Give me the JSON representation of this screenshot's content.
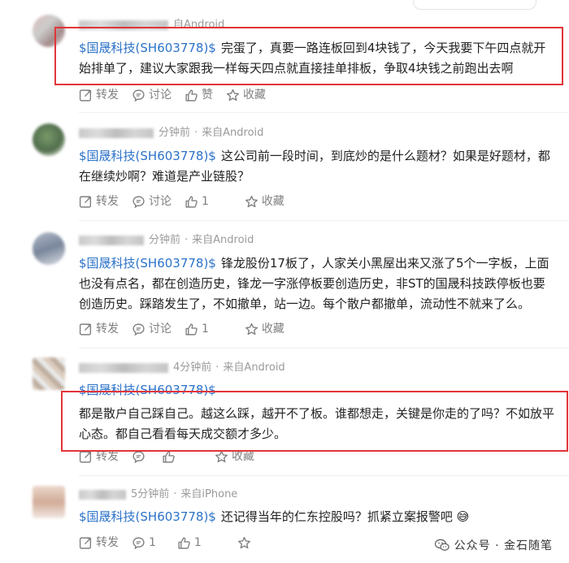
{
  "posts": [
    {
      "meta_time": "",
      "meta_source": "自Android",
      "stock": "$国晟科技(SH603778)$",
      "text": "完蛋了，真要一路连板回到4块钱了，今天我要下午四点就开始排单了，建议大家跟我一样每天四点就直接挂单排板，争取4块钱之前跑出去啊",
      "actions": {
        "repost": "转发",
        "comment": "讨论",
        "like": "赞",
        "fav": "收藏"
      }
    },
    {
      "meta_time": "分钟前",
      "meta_source": "来自Android",
      "stock": "$国晟科技(SH603778)$",
      "text": "这公司前一段时间，到底炒的是什么题材？如果是好题材，都在继续炒啊？难道是产业链股？",
      "actions": {
        "repost": "转发",
        "comment": "讨论",
        "like": "1",
        "fav": "收藏"
      }
    },
    {
      "meta_time": "分钟前",
      "meta_source": "来自Android",
      "stock": "$国晟科技(SH603778)$",
      "text": "锋龙股份17板了，人家关小黑屋出来又涨了5个一字板，上面也没有点名，都在创造历史，锋龙一字涨停板要创造历史，非ST的国晟科技跌停板也要创造历史。踩踏发生了，不如撤单，站一边。每个散户都撤单，流动性不就来了么。",
      "actions": {
        "repost": "转发",
        "comment": "讨论",
        "like": "1",
        "fav": "收藏"
      }
    },
    {
      "meta_time": "4分钟前",
      "meta_source": "来自Android",
      "stock": "$国晟科技(SH603778)$",
      "text": "都是散户自己踩自己。越这么踩，越开不了板。谁都想走，关键是你走的了吗？不如放平心态。都自己看看每天成交额才多少。",
      "actions": {
        "repost": "转发",
        "comment": "",
        "like": "",
        "fav": "收藏"
      }
    },
    {
      "meta_time": "5分钟前",
      "meta_source": "来自iPhone",
      "stock": "$国晟科技(SH603778)$",
      "text": "还记得当年的仁东控股吗？抓紧立案报警吧",
      "emoji": "😅",
      "actions": {
        "repost": "转发",
        "comment": "1",
        "like": "1",
        "fav": ""
      }
    }
  ],
  "watermark": {
    "text": "公众号 · 金石随笔",
    "icon": "wechat-icon"
  },
  "colors": {
    "stock_link": "#2b72c8",
    "highlight_box": "#e2343a",
    "meta": "#9a9a9a",
    "action": "#808080"
  }
}
